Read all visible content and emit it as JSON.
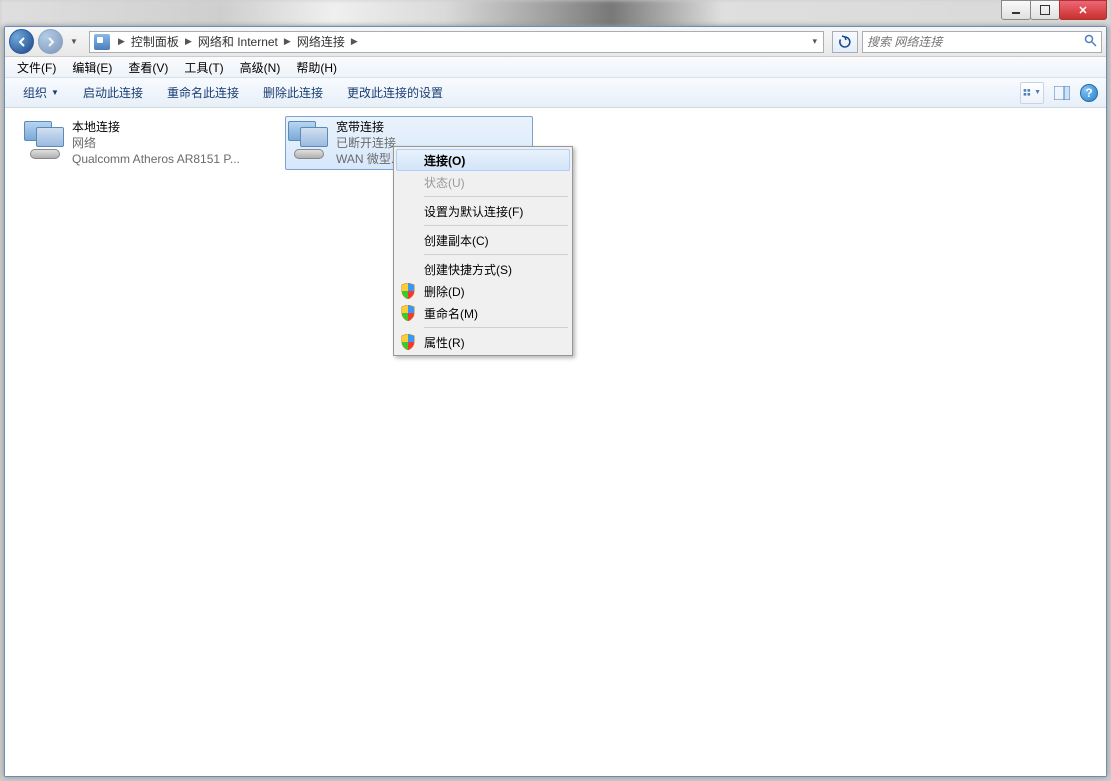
{
  "titlebar": {
    "min": "",
    "max": "",
    "close": ""
  },
  "breadcrumb": {
    "items": [
      "控制面板",
      "网络和 Internet",
      "网络连接"
    ]
  },
  "search": {
    "placeholder": "搜索 网络连接"
  },
  "menubar": {
    "items": [
      "文件(F)",
      "编辑(E)",
      "查看(V)",
      "工具(T)",
      "高级(N)",
      "帮助(H)"
    ]
  },
  "commandbar": {
    "organize": "组织",
    "items": [
      "启动此连接",
      "重命名此连接",
      "删除此连接",
      "更改此连接的设置"
    ]
  },
  "connections": [
    {
      "title": "本地连接",
      "line2": "网络",
      "line3": "Qualcomm Atheros AR8151 P..."
    },
    {
      "title": "宽带连接",
      "line2": "已断开连接",
      "line3": "WAN 微型..."
    }
  ],
  "context_menu": {
    "items": [
      {
        "label": "连接(O)",
        "highlighted": true,
        "shield": false,
        "sep": false,
        "disabled": false
      },
      {
        "label": "状态(U)",
        "highlighted": false,
        "shield": false,
        "sep": false,
        "disabled": true
      },
      {
        "sep": true
      },
      {
        "label": "设置为默认连接(F)",
        "highlighted": false,
        "shield": false,
        "sep": false,
        "disabled": false
      },
      {
        "sep": true
      },
      {
        "label": "创建副本(C)",
        "highlighted": false,
        "shield": false,
        "sep": false,
        "disabled": false
      },
      {
        "sep": true
      },
      {
        "label": "创建快捷方式(S)",
        "highlighted": false,
        "shield": false,
        "sep": false,
        "disabled": false
      },
      {
        "label": "删除(D)",
        "highlighted": false,
        "shield": true,
        "sep": false,
        "disabled": false
      },
      {
        "label": "重命名(M)",
        "highlighted": false,
        "shield": true,
        "sep": false,
        "disabled": false
      },
      {
        "sep": true
      },
      {
        "label": "属性(R)",
        "highlighted": false,
        "shield": true,
        "sep": false,
        "disabled": false
      }
    ]
  }
}
